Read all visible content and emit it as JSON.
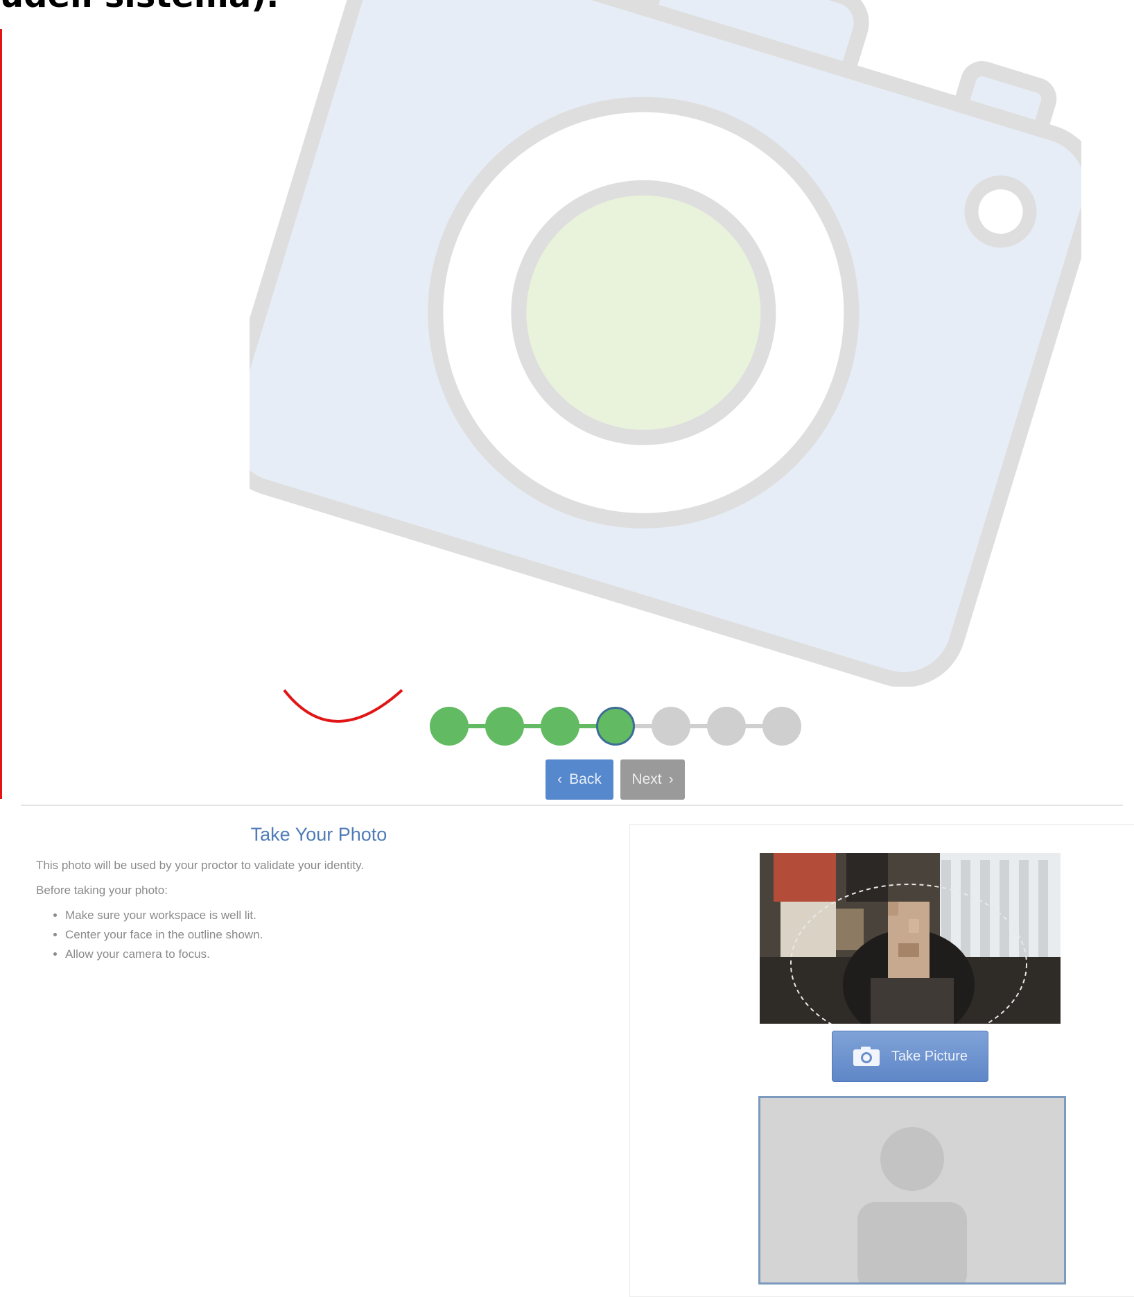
{
  "header": {
    "heading_text": "udeli sistema)."
  },
  "stepper": {
    "steps": [
      "done",
      "done",
      "done",
      "current",
      "todo",
      "todo",
      "todo"
    ],
    "current_step": 4,
    "total_steps": 7
  },
  "nav": {
    "back_label": "Back",
    "next_label": "Next"
  },
  "content": {
    "title": "Take Your Photo",
    "description": "This photo will be used by your proctor to validate your identity.",
    "before_label": "Before taking your photo:",
    "tips": [
      "Make sure your workspace is well lit.",
      "Center your face in the outline shown.",
      "Allow your camera to focus."
    ]
  },
  "camera_panel": {
    "take_picture_label": "Take Picture"
  },
  "colors": {
    "step_done": "#62ba62",
    "step_todo": "#cfcfcf",
    "current_border": "#3d6d96",
    "back_button": "#5588cc",
    "next_button": "#9a9a9a",
    "title_blue": "#4f7cb7",
    "annotation_red": "#e11515"
  }
}
